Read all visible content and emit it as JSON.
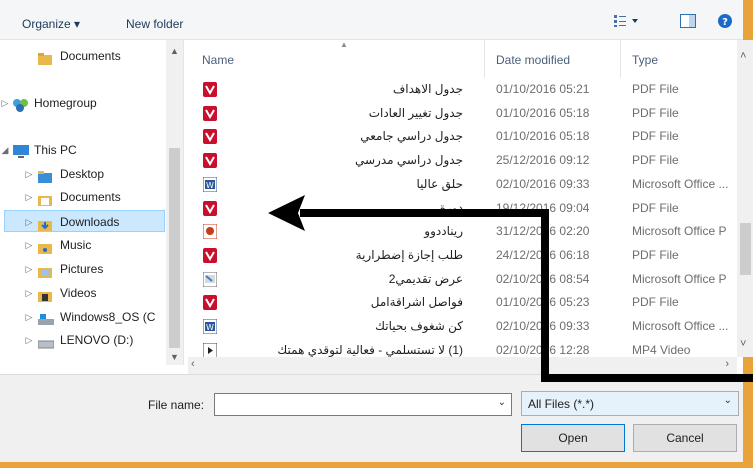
{
  "toolbar": {
    "organize_label": "Organize ▾",
    "new_folder_label": "New folder"
  },
  "nav": {
    "items": [
      {
        "label": "Documents",
        "icon": "folder-icon"
      },
      {
        "label": "Homegroup",
        "icon": "homegroup-icon"
      },
      {
        "label": "This PC",
        "icon": "computer-icon"
      },
      {
        "label": "Desktop",
        "icon": "folder-icon"
      },
      {
        "label": "Documents",
        "icon": "folder-icon"
      },
      {
        "label": "Downloads",
        "icon": "folder-download-icon",
        "selected": true
      },
      {
        "label": "Music",
        "icon": "folder-icon"
      },
      {
        "label": "Pictures",
        "icon": "folder-icon"
      },
      {
        "label": "Videos",
        "icon": "folder-icon"
      },
      {
        "label": "Windows8_OS (C",
        "icon": "drive-icon"
      },
      {
        "label": "LENOVO (D:)",
        "icon": "drive-icon"
      }
    ]
  },
  "list": {
    "headers": {
      "name": "Name",
      "date": "Date modified",
      "type": "Type"
    },
    "rows": [
      {
        "name": "جدول الاهداف",
        "date": "01/10/2016 05:21",
        "type": "PDF File",
        "kind": "pdf"
      },
      {
        "name": "جدول تغيير العادات",
        "date": "01/10/2016 05:18",
        "type": "PDF File",
        "kind": "pdf"
      },
      {
        "name": "جدول دراسي جامعي",
        "date": "01/10/2016 05:18",
        "type": "PDF File",
        "kind": "pdf"
      },
      {
        "name": "جدول دراسي مدرسي",
        "date": "25/12/2016 09:12",
        "type": "PDF File",
        "kind": "pdf"
      },
      {
        "name": "حلق عاليا",
        "date": "02/10/2016 09:33",
        "type": "Microsoft Office ...",
        "kind": "word"
      },
      {
        "name": "دورة",
        "date": "19/12/2016 09:04",
        "type": "PDF File",
        "kind": "pdf"
      },
      {
        "name": "ريناددوو",
        "date": "31/12/2016 02:20",
        "type": "Microsoft Office P",
        "kind": "ppt"
      },
      {
        "name": "طلب إجازة إضطرارية",
        "date": "24/12/2016 06:18",
        "type": "PDF File",
        "kind": "pdf"
      },
      {
        "name": "عرض تقديمي2",
        "date": "02/10/2016 08:54",
        "type": "Microsoft Office P",
        "kind": "pptx"
      },
      {
        "name": "فواصل اشراقةامل",
        "date": "01/10/2016 05:23",
        "type": "PDF File",
        "kind": "pdf"
      },
      {
        "name": "كن شغوف بحياتك",
        "date": "02/10/2016 09:33",
        "type": "Microsoft Office ...",
        "kind": "word"
      },
      {
        "name": "(1) لا تستسلمي - فعالية لتوقدي همتك",
        "date": "02/10/2016 12:28",
        "type": "MP4 Video",
        "kind": "video"
      }
    ]
  },
  "bottom": {
    "filename_label": "File name:",
    "filename_value": "",
    "filter_value": "All Files (*.*)",
    "open_label": "Open",
    "cancel_label": "Cancel"
  },
  "colors": {
    "accent_orange": "#e8a33a",
    "selection": "#cce8ff",
    "pdf_red": "#c8102e",
    "word_blue": "#2b579a"
  }
}
